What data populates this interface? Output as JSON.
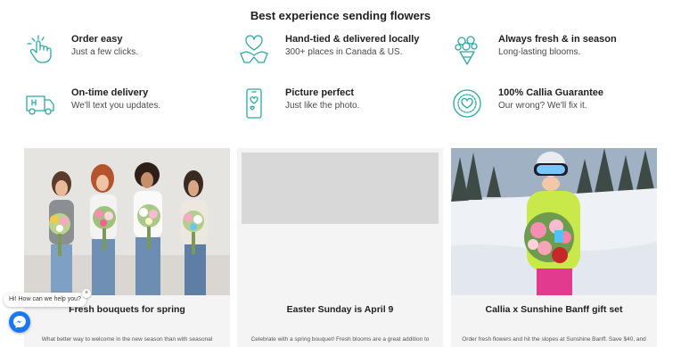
{
  "section": {
    "title": "Best experience sending flowers"
  },
  "features": [
    {
      "title": "Order easy",
      "subtitle": "Just a few clicks.",
      "icon": "click-hand-icon"
    },
    {
      "title": "Hand-tied & delivered locally",
      "subtitle": "300+ places in Canada & US.",
      "icon": "hands-heart-icon"
    },
    {
      "title": "Always fresh & in season",
      "subtitle": "Long-lasting blooms.",
      "icon": "bouquet-icon"
    },
    {
      "title": "On-time delivery",
      "subtitle": "We'll text you updates.",
      "icon": "delivery-van-icon"
    },
    {
      "title": "Picture perfect",
      "subtitle": "Just like the photo.",
      "icon": "phone-heart-icon"
    },
    {
      "title": "100% Callia Guarantee",
      "subtitle": "Our wrong? We'll fix it.",
      "icon": "guarantee-seal-icon"
    }
  ],
  "cards": [
    {
      "title": "Fresh bouquets for spring",
      "description": "What better way to welcome in the new season than with seasonal"
    },
    {
      "title": "Easter Sunday is April 9",
      "description": "Celebrate with a spring bouquet! Fresh blooms are a great addition to"
    },
    {
      "title": "Callia x Sunshine Banff gift set",
      "description": "Order fresh flowers and hit the slopes at Sunshine Banff. Save $40, and"
    }
  ],
  "chat": {
    "prompt": "Hi! How can we help you?",
    "close": "×"
  },
  "colors": {
    "accent": "#2aa9a3",
    "chat": "#1877f2"
  }
}
